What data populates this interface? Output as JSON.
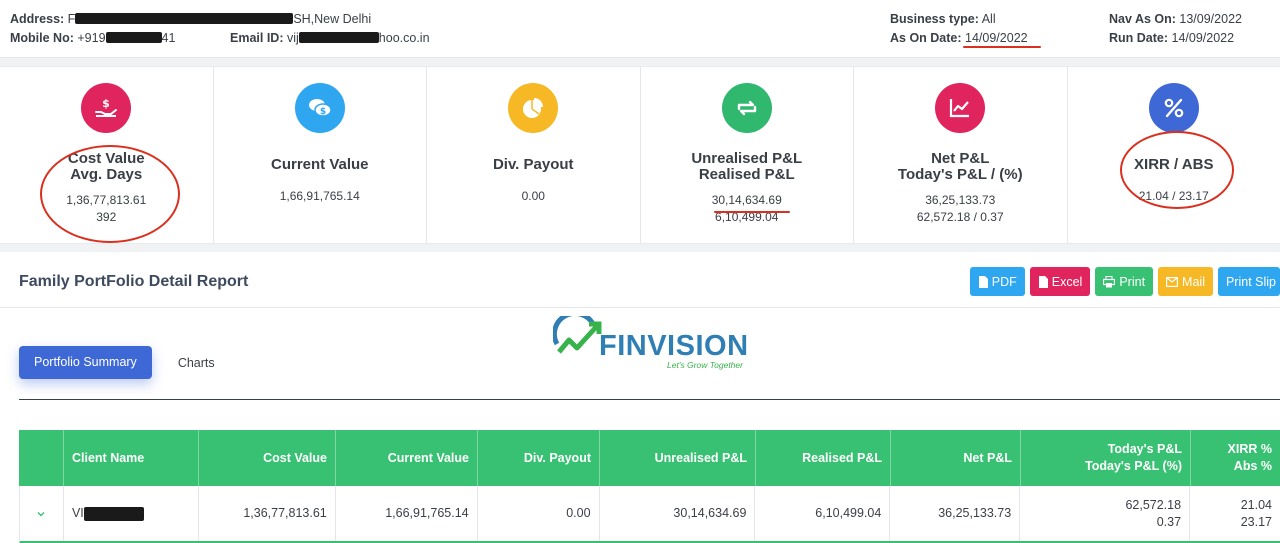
{
  "header": {
    "address_label": "Address:",
    "address_prefix": "F",
    "address_suffix": "SH,New Delhi",
    "mobile_label": "Mobile No:",
    "mobile_prefix": "+919",
    "mobile_suffix": "41",
    "email_label": "Email ID:",
    "email_prefix": "vij",
    "email_suffix": "hoo.co.in",
    "business_type_label": "Business type:",
    "business_type_value": "All",
    "as_on_label": "As On Date:",
    "as_on_value": "14/09/2022",
    "nav_as_on_label": "Nav As On:",
    "nav_as_on_value": "13/09/2022",
    "run_date_label": "Run Date:",
    "run_date_value": "14/09/2022"
  },
  "cards": [
    {
      "title1": "Cost Value",
      "title2": "Avg. Days",
      "v1": "1,36,77,813.61",
      "v2": "392",
      "icon": "hand-dollar-icon",
      "color": "#e0245e"
    },
    {
      "title1": "Current Value",
      "title2": "",
      "v1": "1,66,91,765.14",
      "v2": "",
      "icon": "chat-dollar-icon",
      "color": "#2ea6f0"
    },
    {
      "title1": "Div. Payout",
      "title2": "",
      "v1": "0.00",
      "v2": "",
      "icon": "pie-chart-icon",
      "color": "#f6b824"
    },
    {
      "title1": "Unrealised P&L",
      "title2": "Realised P&L",
      "v1": "30,14,634.69",
      "v2": "6,10,499.04",
      "icon": "exchange-icon",
      "color": "#2fb86e"
    },
    {
      "title1": "Net P&L",
      "title2": "Today's P&L / (%)",
      "v1": "36,25,133.73",
      "v2": "62,572.18 / 0.37",
      "icon": "line-chart-icon",
      "color": "#e0245e"
    },
    {
      "title1": "XIRR / ABS",
      "title2": "",
      "v1": "21.04 / 23.17",
      "v2": "",
      "icon": "percent-icon",
      "color": "#3d68d6"
    }
  ],
  "report": {
    "title": "Family PortFolio Detail Report",
    "buttons": {
      "pdf": "PDF",
      "excel": "Excel",
      "print": "Print",
      "mail": "Mail",
      "print_slip": "Print Slip"
    },
    "colors": {
      "pdf": "#2ea6f0",
      "excel": "#e0245e",
      "print": "#38c172",
      "mail": "#f6b824",
      "print_slip": "#2ea6f0"
    }
  },
  "logo": {
    "name": "FINVISION",
    "tagline": "Let's Grow Together"
  },
  "tabs": {
    "active": "Portfolio Summary",
    "other": "Charts"
  },
  "table": {
    "headers": {
      "client_name": "Client Name",
      "cost_value": "Cost Value",
      "current_value": "Current Value",
      "div_payout": "Div. Payout",
      "unrealised": "Unrealised P&L",
      "realised": "Realised P&L",
      "net": "Net P&L",
      "today1": "Today's P&L",
      "today2": "Today's P&L (%)",
      "xirr1": "XIRR %",
      "xirr2": "Abs %"
    },
    "row": {
      "client_prefix": "VI",
      "cost_value": "1,36,77,813.61",
      "current_value": "1,66,91,765.14",
      "div_payout": "0.00",
      "unrealised": "30,14,634.69",
      "realised": "6,10,499.04",
      "net": "36,25,133.73",
      "today1": "62,572.18",
      "today2": "0.37",
      "xirr1": "21.04",
      "xirr2": "23.17"
    }
  }
}
